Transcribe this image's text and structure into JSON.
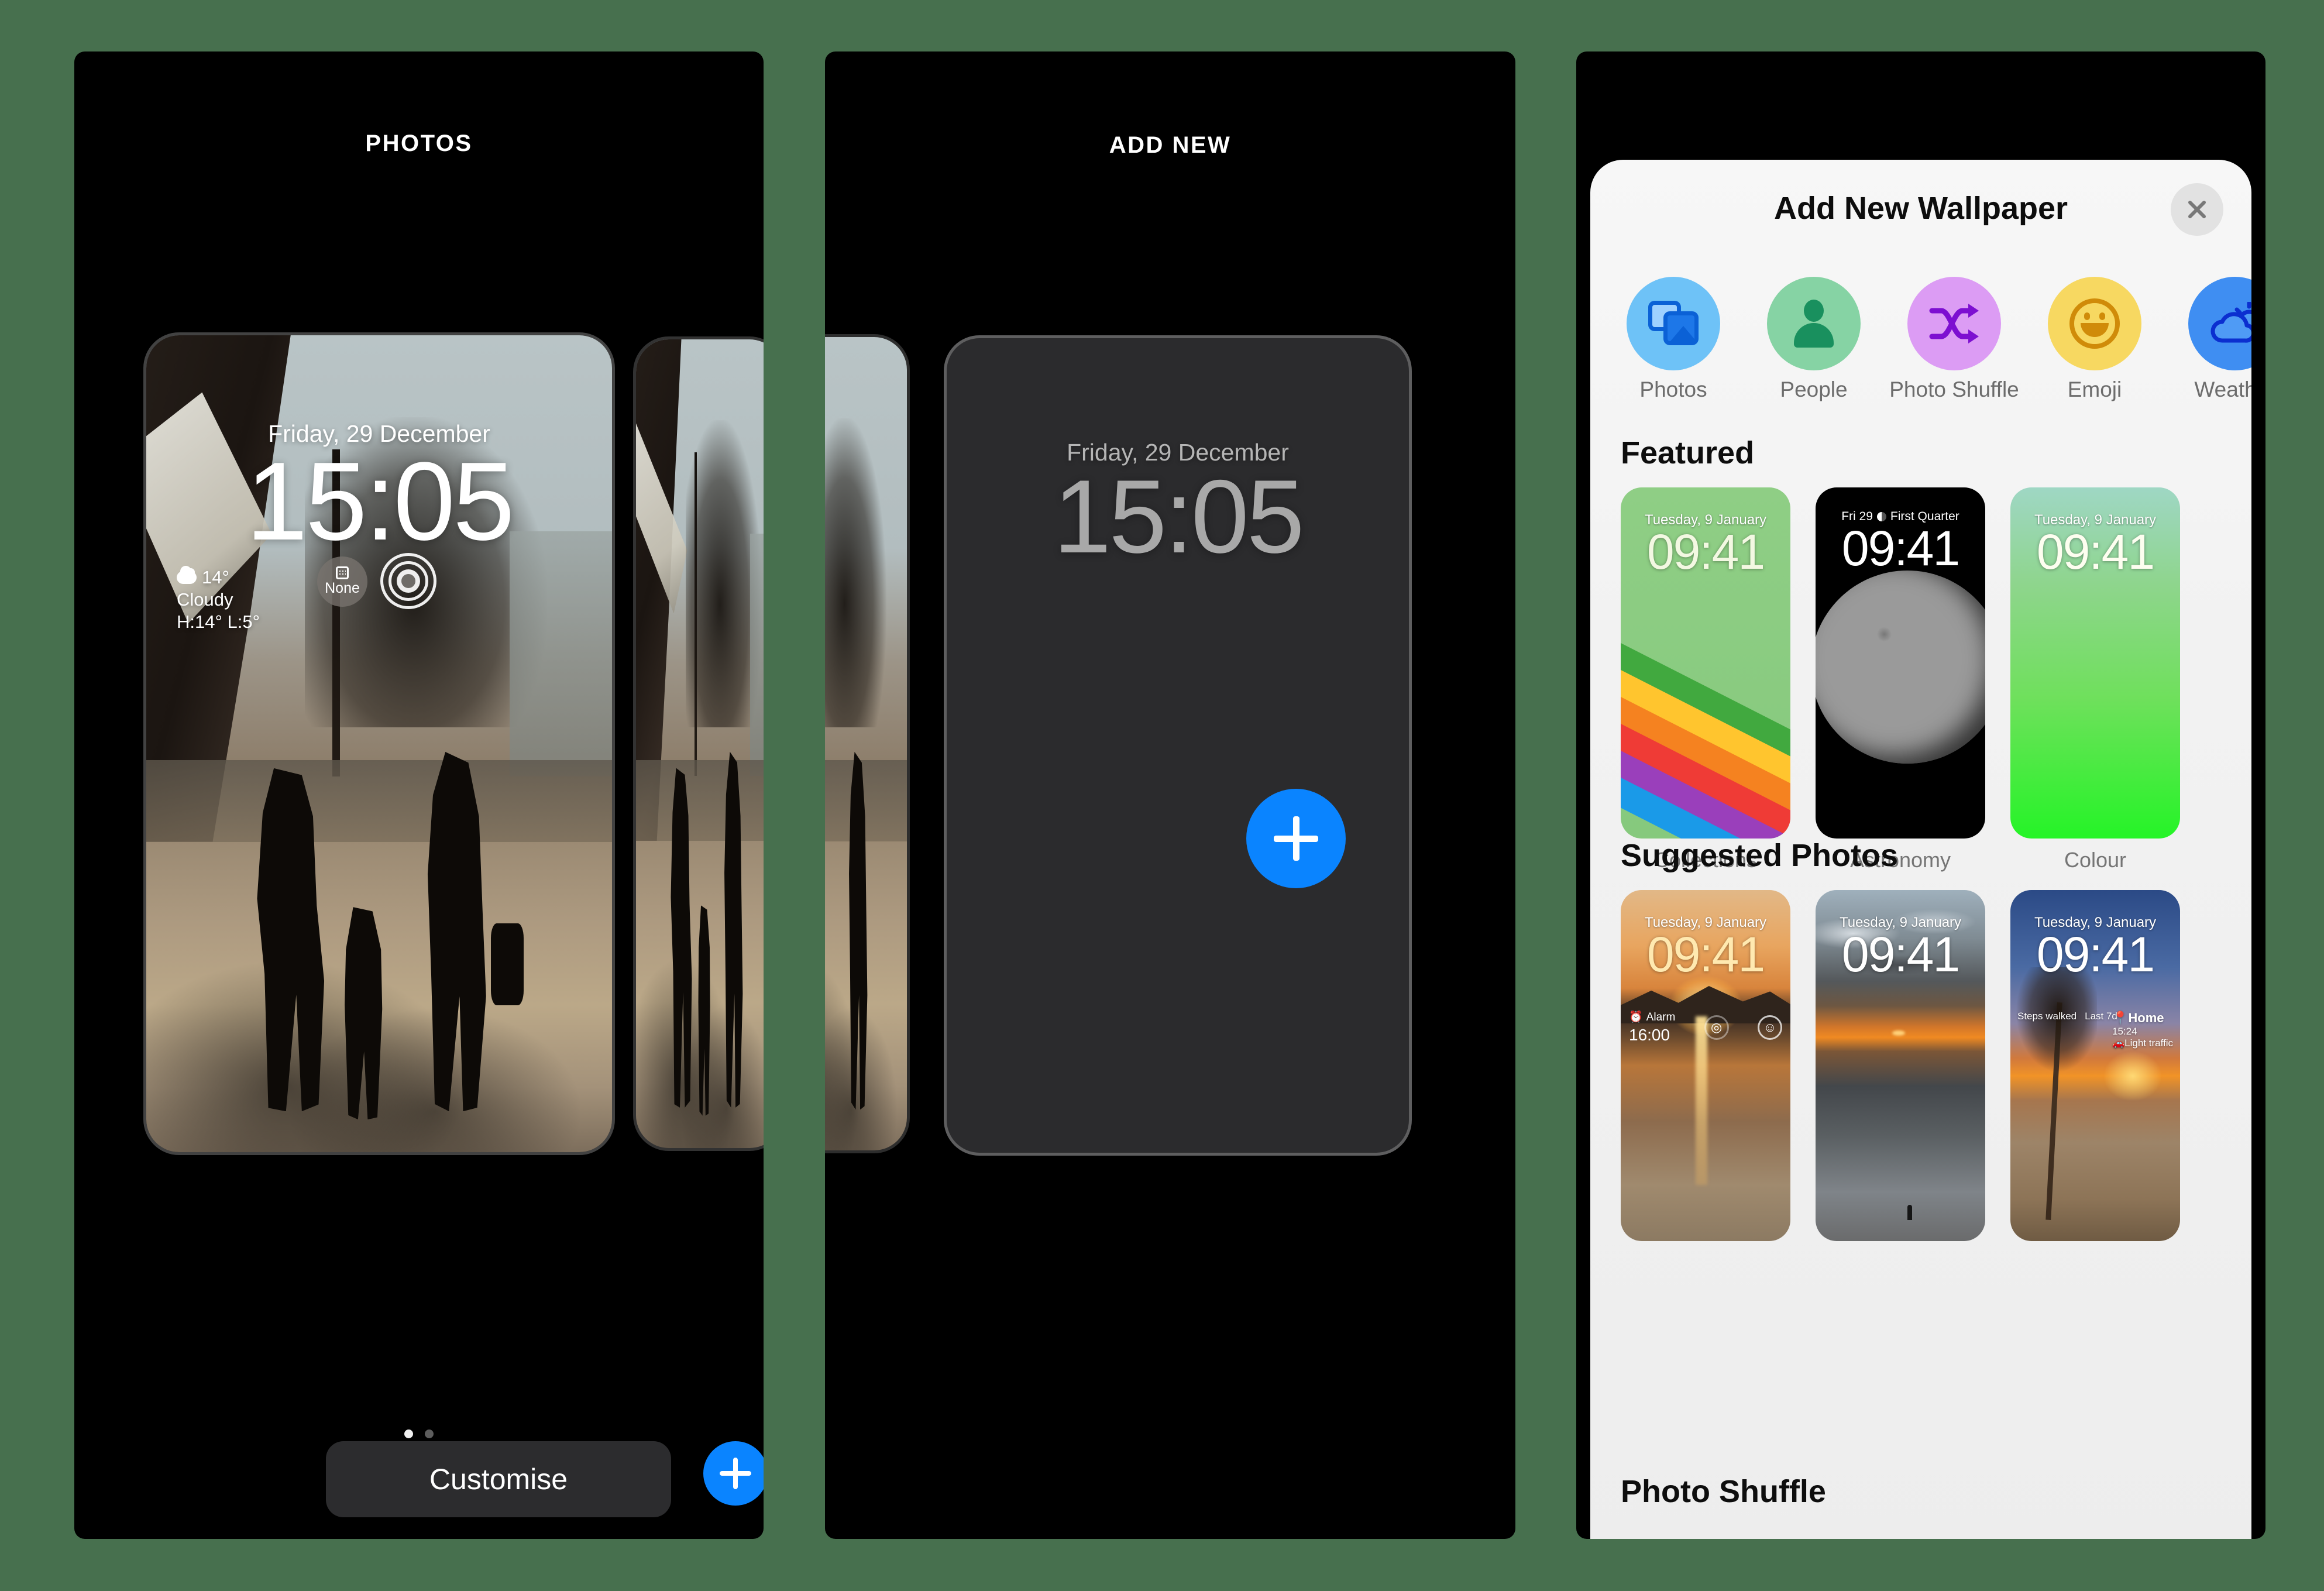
{
  "background_color": "#47704e",
  "accent_blue": "#0a84ff",
  "panels": [
    {
      "id": "photos",
      "heading": "PHOTOS",
      "lock_screen": {
        "date": "Friday, 29 December",
        "time": "15:05",
        "weather": {
          "temp": "14°",
          "condition": "Cloudy",
          "high_low": "H:14° L:5°"
        },
        "widget_none_label": "None"
      },
      "page_dots": {
        "count": 2,
        "active_index": 0
      },
      "customise_label": "Customise",
      "add_button_label": "+"
    },
    {
      "id": "add-new",
      "heading": "ADD NEW",
      "preview": {
        "date": "Friday, 29 December",
        "time": "15:05"
      },
      "add_button_label": "+"
    },
    {
      "id": "picker",
      "sheet": {
        "title": "Add New Wallpaper",
        "close_label": "×",
        "categories": [
          {
            "label": "Photos",
            "icon": "photos-icon",
            "color": "#6ec2f7"
          },
          {
            "label": "People",
            "icon": "person-icon",
            "color": "#86d3a4"
          },
          {
            "label": "Photo Shuffle",
            "icon": "shuffle-icon",
            "color": "#dc9cf4"
          },
          {
            "label": "Emoji",
            "icon": "smiley-icon",
            "color": "#f7d861"
          },
          {
            "label": "Weather",
            "icon": "cloud-sun-icon",
            "color": "#3f8ef2"
          }
        ],
        "sections": [
          {
            "title": "Featured",
            "cards": [
              {
                "caption": "Collections",
                "date": "Tuesday, 9 January",
                "time": "09:41"
              },
              {
                "caption": "Astronomy",
                "date": "Fri 29",
                "date_extra": "First Quarter",
                "time": "09:41"
              },
              {
                "caption": "Colour",
                "date": "Tuesday, 9 January",
                "time": "09:41"
              }
            ]
          },
          {
            "title": "Suggested Photos",
            "cards": [
              {
                "date": "Tuesday, 9 January",
                "time": "09:41",
                "widgets": {
                  "alarm_label": "Alarm",
                  "alarm_time": "16:00"
                }
              },
              {
                "date": "Tuesday, 9 January",
                "time": "09:41"
              },
              {
                "date": "Tuesday, 9 January",
                "time": "09:41",
                "widgets": {
                  "steps_label": "Steps walked",
                  "steps_range": "Last 7d",
                  "place": "Home",
                  "place_time": "15:24",
                  "traffic": "Light traffic"
                }
              }
            ]
          },
          {
            "title": "Photo Shuffle",
            "cards": []
          }
        ]
      }
    }
  ]
}
